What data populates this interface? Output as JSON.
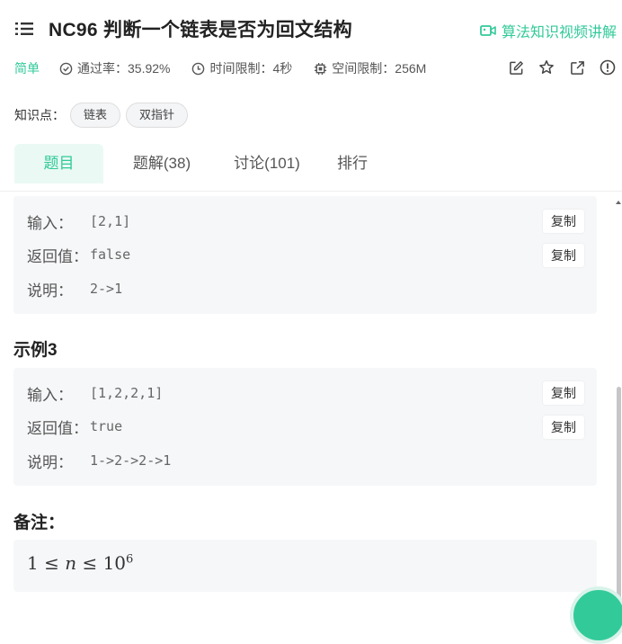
{
  "header": {
    "title": "NC96  判断一个链表是否为回文结构",
    "video_link": "算法知识视频讲解",
    "difficulty": "简单",
    "pass_rate": "通过率：35.92%",
    "time_limit": "时间限制：4秒",
    "space_limit": "空间限制：256M",
    "knowledge_label": "知识点：",
    "tags": [
      "链表",
      "双指针"
    ],
    "tabs": [
      "题目",
      "题解(38)",
      "讨论(101)",
      "排行"
    ]
  },
  "examples": [
    {
      "input_label": "输入：",
      "input": "[2,1]",
      "return_label": "返回值：",
      "return": "false",
      "explain_label": "说明：",
      "explain": "2->1"
    },
    {
      "heading": "示例3",
      "input_label": "输入：",
      "input": "[1,2,2,1]",
      "return_label": "返回值：",
      "return": "true",
      "explain_label": "说明：",
      "explain": "1->2->2->1"
    }
  ],
  "copy_label": "复制",
  "notes": {
    "heading": "备注：",
    "formula_left": "1 ≤ ",
    "formula_var": "n",
    "formula_right": " ≤ 10",
    "formula_exp": "6"
  },
  "colors": {
    "accent": "#32ca99",
    "box_bg": "#f6f7f9",
    "tab_active_bg": "#eaf9f4"
  }
}
